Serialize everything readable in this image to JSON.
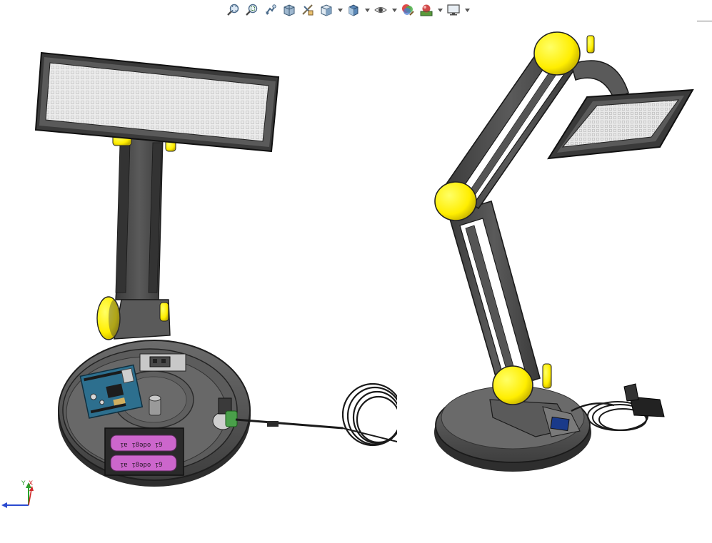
{
  "toolbar": {
    "items": [
      {
        "name": "zoom-to-fit-icon",
        "caret": false
      },
      {
        "name": "zoom-to-area-icon",
        "caret": false
      },
      {
        "name": "previous-view-icon",
        "caret": false
      },
      {
        "name": "section-view-icon",
        "caret": false
      },
      {
        "name": "dynamic-annotation-icon",
        "caret": false
      },
      {
        "name": "view-orientation-icon",
        "caret": true
      },
      {
        "name": "display-style-icon",
        "caret": true
      },
      {
        "name": "hide-show-items-icon",
        "caret": true
      },
      {
        "name": "edit-appearance-icon",
        "caret": false
      },
      {
        "name": "apply-scene-icon",
        "caret": true
      },
      {
        "name": "view-settings-icon",
        "caret": true
      }
    ]
  },
  "triad": {
    "x_label": "X",
    "y_label": "Y",
    "z_label": "Z"
  },
  "colors": {
    "body_dark": "#4a4a4a",
    "body_mid": "#6b6b6b",
    "joint_yellow": "#ffee00",
    "battery_purple": "#cc66cc",
    "board_blue": "#2d6f8e",
    "led_panel": "#e9e9e9"
  }
}
